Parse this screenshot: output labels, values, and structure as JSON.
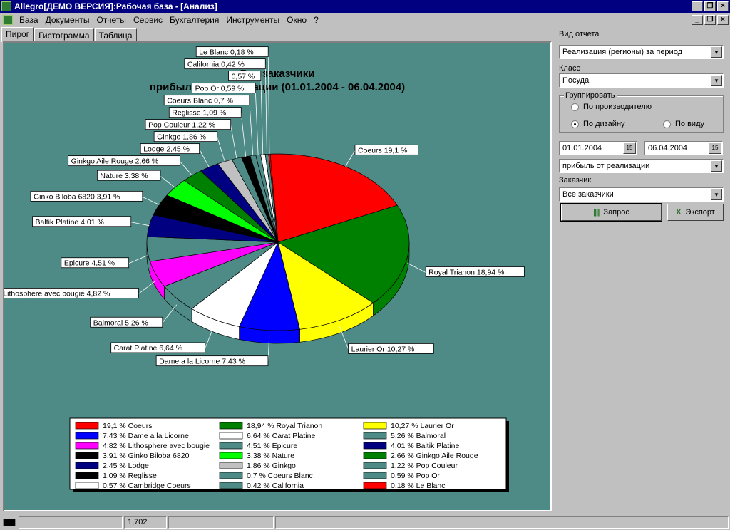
{
  "titlebar": {
    "title": "Allegro[ДЕМО ВЕРСИЯ]:Рабочая база - [Анализ]"
  },
  "menu": [
    "База",
    "Документы",
    "Отчеты",
    "Сервис",
    "Бухгалтерия",
    "Инструменты",
    "Окно",
    "?"
  ],
  "tabs": [
    "Пирог",
    "Гистограмма",
    "Таблица"
  ],
  "panel": {
    "report_type_label": "Вид отчета",
    "report_type_value": "Реализация (регионы) за период",
    "class_label": "Класс",
    "class_value": "Посуда",
    "group_label": "Группировать",
    "group_options": [
      "По производителю",
      "По дизайну",
      "По виду"
    ],
    "group_selected": "По дизайну",
    "date_from": "01.01.2004",
    "date_to": "06.04.2004",
    "calendar_label": "15",
    "measure_value": "прибыль от реализации",
    "customer_label": "Заказчик",
    "customer_value": "Все заказчики",
    "query_button": "Запрос",
    "export_button": "Экспорт"
  },
  "status": {
    "value": "1,702"
  },
  "chart_data": {
    "type": "pie",
    "title": "Все заказчики",
    "subtitle": "прибыль от реализации (01.01.2004 - 06.04.2004)",
    "legend_position": "bottom",
    "slices": [
      {
        "name": "Coeurs",
        "value": 19.1,
        "pct": "19,1 %",
        "color": "#ff0000"
      },
      {
        "name": "Royal Trianon",
        "value": 18.94,
        "pct": "18,94 %",
        "color": "#008000"
      },
      {
        "name": "Laurier Or",
        "value": 10.27,
        "pct": "10,27 %",
        "color": "#ffff00"
      },
      {
        "name": "Dame a la Licorne",
        "value": 7.43,
        "pct": "7,43 %",
        "color": "#0000ff"
      },
      {
        "name": "Carat Platine",
        "value": 6.64,
        "pct": "6,64 %",
        "color": "#ffffff"
      },
      {
        "name": "Balmoral",
        "value": 5.26,
        "pct": "5,26 %",
        "color": "#4e8a86"
      },
      {
        "name": "Lithosphere avec bougie",
        "value": 4.82,
        "pct": "4,82 %",
        "color": "#ff00ff"
      },
      {
        "name": "Epicure",
        "value": 4.51,
        "pct": "4,51 %",
        "color": "#4e8a86"
      },
      {
        "name": "Baltik Platine",
        "value": 4.01,
        "pct": "4,01 %",
        "color": "#000080"
      },
      {
        "name": "Ginko Biloba 6820",
        "value": 3.91,
        "pct": "3,91 %",
        "color": "#000000"
      },
      {
        "name": "Nature",
        "value": 3.38,
        "pct": "3,38 %",
        "color": "#00ff00"
      },
      {
        "name": "Ginkgo Aile Rouge",
        "value": 2.66,
        "pct": "2,66 %",
        "color": "#008000"
      },
      {
        "name": "Lodge",
        "value": 2.45,
        "pct": "2,45 %",
        "color": "#000080"
      },
      {
        "name": "Ginkgo",
        "value": 1.86,
        "pct": "1,86 %",
        "color": "#c0c0c0"
      },
      {
        "name": "Pop Couleur",
        "value": 1.22,
        "pct": "1,22 %",
        "color": "#4e8a86"
      },
      {
        "name": "Reglisse",
        "value": 1.09,
        "pct": "1,09 %",
        "color": "#000000"
      },
      {
        "name": "Coeurs Blanc",
        "value": 0.7,
        "pct": "0,7 %",
        "color": "#4e8a86"
      },
      {
        "name": "Pop Or",
        "value": 0.59,
        "pct": "0,59 %",
        "color": "#4e8a86"
      },
      {
        "name": "Cambridge Coeurs",
        "value": 0.57,
        "pct": "0,57 %",
        "color": "#ffffff"
      },
      {
        "name": "California",
        "value": 0.42,
        "pct": "0,42 %",
        "color": "#4e8a86"
      },
      {
        "name": "Le Blanc",
        "value": 0.18,
        "pct": "0,18 %",
        "color": "#ff0000"
      }
    ],
    "pie_labels": [
      "Coeurs 19,1 %",
      "Royal Trianon 18,94 %",
      "Laurier Or 10,27 %",
      "Dame a la Licorne 7,43 %",
      "Carat Platine 6,64 %",
      "Balmoral 5,26 %",
      "Lithosphere avec bougie 4,82 %",
      "Epicure 4,51 %",
      "Baltik Platine 4,01 %",
      "Ginko Biloba 6820 3,91 %",
      "Nature 3,38 %",
      "Ginkgo Aile Rouge 2,66 %",
      "Lodge 2,45 %",
      "Ginkgo 1,86 %",
      "Pop Couleur 1,22 %",
      "Reglisse 1,09 %",
      "Coeurs Blanc 0,7 %",
      "Pop Or 0,59 %",
      "0,57 %",
      "California 0,42 %",
      "Le Blanc 0,18 %"
    ],
    "legend": [
      "19,1 % Coeurs",
      "18,94 % Royal Trianon",
      "10,27 % Laurier Or",
      "7,43 % Dame a la Licorne",
      "6,64 % Carat Platine",
      "5,26 % Balmoral",
      "4,82 % Lithosphere avec bougie",
      "4,51 % Epicure",
      "4,01 % Baltik Platine",
      "3,91 % Ginko Biloba 6820",
      "3,38 % Nature",
      "2,66 % Ginkgo Aile Rouge",
      "2,45 % Lodge",
      "1,86 % Ginkgo",
      "1,22 % Pop Couleur",
      "1,09 % Reglisse",
      "0,7 % Coeurs Blanc",
      "0,59 % Pop Or",
      "0,57 % Cambridge Coeurs",
      "0,42 % California",
      "0,18 % Le Blanc"
    ]
  }
}
